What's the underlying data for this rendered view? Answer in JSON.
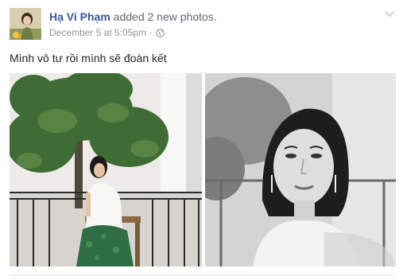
{
  "post": {
    "author_name": "Hạ Vi Phạm",
    "action_text": "added 2 new photos.",
    "timestamp": "December 5 at 5:05pm",
    "meta_separator": "·",
    "privacy_icon": "globe-icon",
    "menu_icon": "chevron-down-icon",
    "text": "Mình vô tư rồi mình sẽ đoàn kết"
  },
  "photos": [
    {
      "name": "photo-woman-seated-under-tree",
      "style": "color"
    },
    {
      "name": "photo-woman-portrait",
      "style": "black-and-white"
    }
  ],
  "colors": {
    "link": "#365899",
    "secondary_text": "#90949c",
    "primary_text": "#1d2129"
  }
}
